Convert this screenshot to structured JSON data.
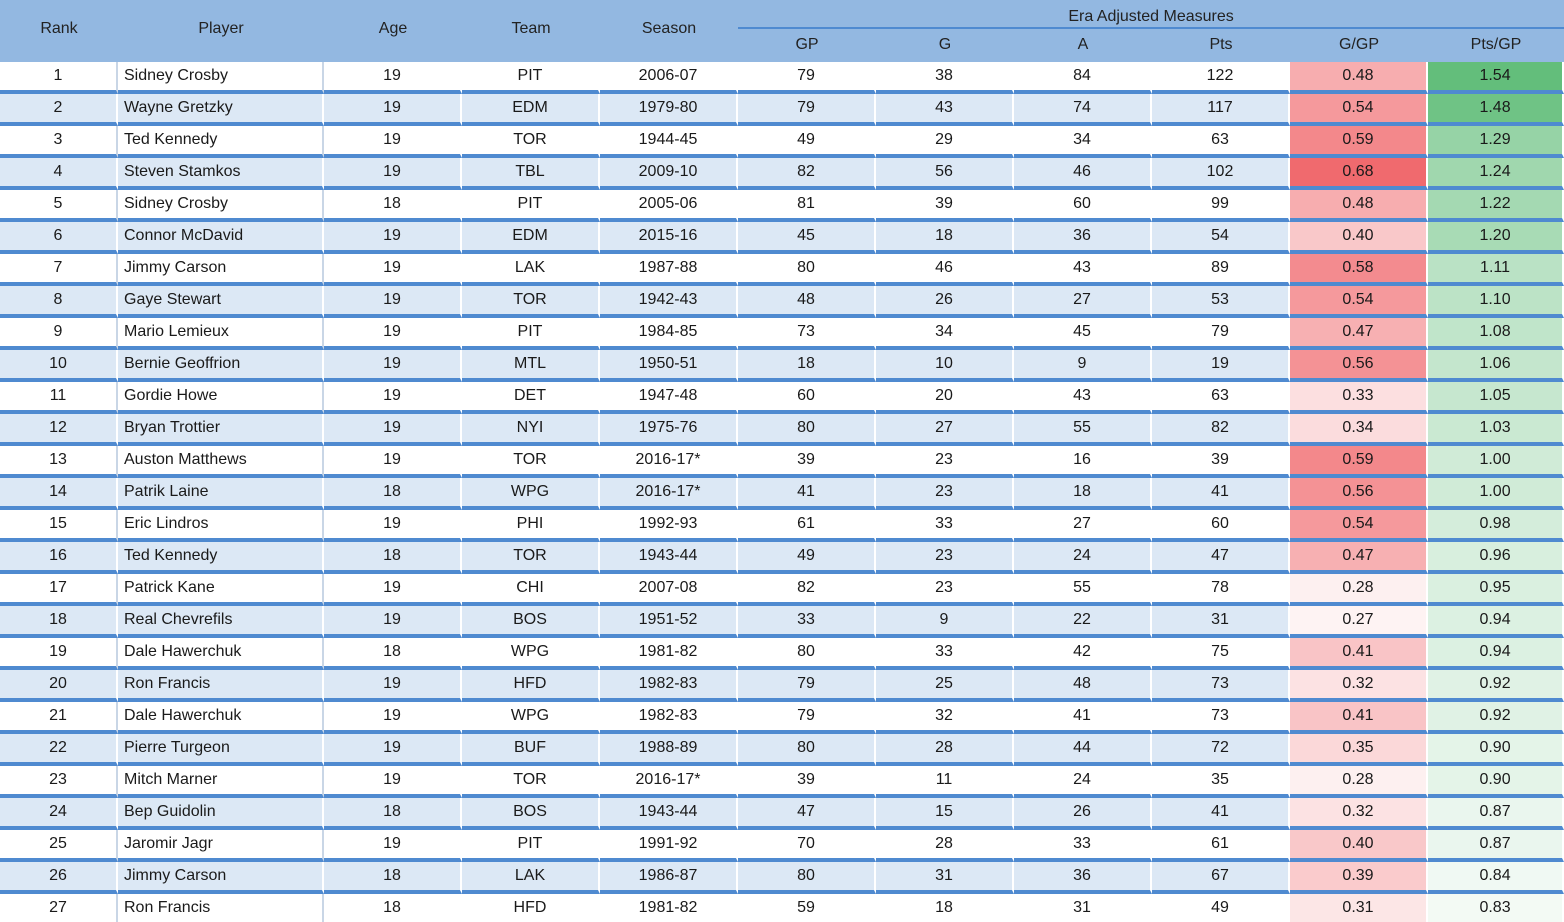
{
  "header": {
    "group_title": "Era Adjusted Measures",
    "columns": {
      "rank": "Rank",
      "player": "Player",
      "age": "Age",
      "team": "Team",
      "season": "Season",
      "gp": "GP",
      "g": "G",
      "a": "A",
      "pts": "Pts",
      "g_per_gp": "G/GP",
      "pts_per_gp": "Pts/GP"
    }
  },
  "colors": {
    "header_bg": "#93b8e1",
    "row_alt_bg": "#dce8f5",
    "row_divider": "#4f8ad0",
    "heat_red": "#f06a6e",
    "heat_green": "#63be7b"
  },
  "rows": [
    {
      "rank": "1",
      "player": "Sidney Crosby",
      "age": "19",
      "team": "PIT",
      "season": "2006-07",
      "gp": "79",
      "g": "38",
      "a": "84",
      "pts": "122",
      "g_per_gp": "0.48",
      "pts_per_gp": "1.54"
    },
    {
      "rank": "2",
      "player": "Wayne Gretzky",
      "age": "19",
      "team": "EDM",
      "season": "1979-80",
      "gp": "79",
      "g": "43",
      "a": "74",
      "pts": "117",
      "g_per_gp": "0.54",
      "pts_per_gp": "1.48"
    },
    {
      "rank": "3",
      "player": "Ted Kennedy",
      "age": "19",
      "team": "TOR",
      "season": "1944-45",
      "gp": "49",
      "g": "29",
      "a": "34",
      "pts": "63",
      "g_per_gp": "0.59",
      "pts_per_gp": "1.29"
    },
    {
      "rank": "4",
      "player": "Steven Stamkos",
      "age": "19",
      "team": "TBL",
      "season": "2009-10",
      "gp": "82",
      "g": "56",
      "a": "46",
      "pts": "102",
      "g_per_gp": "0.68",
      "pts_per_gp": "1.24"
    },
    {
      "rank": "5",
      "player": "Sidney Crosby",
      "age": "18",
      "team": "PIT",
      "season": "2005-06",
      "gp": "81",
      "g": "39",
      "a": "60",
      "pts": "99",
      "g_per_gp": "0.48",
      "pts_per_gp": "1.22"
    },
    {
      "rank": "6",
      "player": "Connor McDavid",
      "age": "19",
      "team": "EDM",
      "season": "2015-16",
      "gp": "45",
      "g": "18",
      "a": "36",
      "pts": "54",
      "g_per_gp": "0.40",
      "pts_per_gp": "1.20"
    },
    {
      "rank": "7",
      "player": "Jimmy Carson",
      "age": "19",
      "team": "LAK",
      "season": "1987-88",
      "gp": "80",
      "g": "46",
      "a": "43",
      "pts": "89",
      "g_per_gp": "0.58",
      "pts_per_gp": "1.11"
    },
    {
      "rank": "8",
      "player": "Gaye Stewart",
      "age": "19",
      "team": "TOR",
      "season": "1942-43",
      "gp": "48",
      "g": "26",
      "a": "27",
      "pts": "53",
      "g_per_gp": "0.54",
      "pts_per_gp": "1.10"
    },
    {
      "rank": "9",
      "player": "Mario Lemieux",
      "age": "19",
      "team": "PIT",
      "season": "1984-85",
      "gp": "73",
      "g": "34",
      "a": "45",
      "pts": "79",
      "g_per_gp": "0.47",
      "pts_per_gp": "1.08"
    },
    {
      "rank": "10",
      "player": "Bernie Geoffrion",
      "age": "19",
      "team": "MTL",
      "season": "1950-51",
      "gp": "18",
      "g": "10",
      "a": "9",
      "pts": "19",
      "g_per_gp": "0.56",
      "pts_per_gp": "1.06"
    },
    {
      "rank": "11",
      "player": "Gordie Howe",
      "age": "19",
      "team": "DET",
      "season": "1947-48",
      "gp": "60",
      "g": "20",
      "a": "43",
      "pts": "63",
      "g_per_gp": "0.33",
      "pts_per_gp": "1.05"
    },
    {
      "rank": "12",
      "player": "Bryan Trottier",
      "age": "19",
      "team": "NYI",
      "season": "1975-76",
      "gp": "80",
      "g": "27",
      "a": "55",
      "pts": "82",
      "g_per_gp": "0.34",
      "pts_per_gp": "1.03"
    },
    {
      "rank": "13",
      "player": "Auston Matthews",
      "age": "19",
      "team": "TOR",
      "season": "2016-17*",
      "gp": "39",
      "g": "23",
      "a": "16",
      "pts": "39",
      "g_per_gp": "0.59",
      "pts_per_gp": "1.00"
    },
    {
      "rank": "14",
      "player": "Patrik Laine",
      "age": "18",
      "team": "WPG",
      "season": "2016-17*",
      "gp": "41",
      "g": "23",
      "a": "18",
      "pts": "41",
      "g_per_gp": "0.56",
      "pts_per_gp": "1.00"
    },
    {
      "rank": "15",
      "player": "Eric Lindros",
      "age": "19",
      "team": "PHI",
      "season": "1992-93",
      "gp": "61",
      "g": "33",
      "a": "27",
      "pts": "60",
      "g_per_gp": "0.54",
      "pts_per_gp": "0.98"
    },
    {
      "rank": "16",
      "player": "Ted Kennedy",
      "age": "18",
      "team": "TOR",
      "season": "1943-44",
      "gp": "49",
      "g": "23",
      "a": "24",
      "pts": "47",
      "g_per_gp": "0.47",
      "pts_per_gp": "0.96"
    },
    {
      "rank": "17",
      "player": "Patrick Kane",
      "age": "19",
      "team": "CHI",
      "season": "2007-08",
      "gp": "82",
      "g": "23",
      "a": "55",
      "pts": "78",
      "g_per_gp": "0.28",
      "pts_per_gp": "0.95"
    },
    {
      "rank": "18",
      "player": "Real Chevrefils",
      "age": "19",
      "team": "BOS",
      "season": "1951-52",
      "gp": "33",
      "g": "9",
      "a": "22",
      "pts": "31",
      "g_per_gp": "0.27",
      "pts_per_gp": "0.94"
    },
    {
      "rank": "19",
      "player": "Dale Hawerchuk",
      "age": "18",
      "team": "WPG",
      "season": "1981-82",
      "gp": "80",
      "g": "33",
      "a": "42",
      "pts": "75",
      "g_per_gp": "0.41",
      "pts_per_gp": "0.94"
    },
    {
      "rank": "20",
      "player": "Ron Francis",
      "age": "19",
      "team": "HFD",
      "season": "1982-83",
      "gp": "79",
      "g": "25",
      "a": "48",
      "pts": "73",
      "g_per_gp": "0.32",
      "pts_per_gp": "0.92"
    },
    {
      "rank": "21",
      "player": "Dale Hawerchuk",
      "age": "19",
      "team": "WPG",
      "season": "1982-83",
      "gp": "79",
      "g": "32",
      "a": "41",
      "pts": "73",
      "g_per_gp": "0.41",
      "pts_per_gp": "0.92"
    },
    {
      "rank": "22",
      "player": "Pierre Turgeon",
      "age": "19",
      "team": "BUF",
      "season": "1988-89",
      "gp": "80",
      "g": "28",
      "a": "44",
      "pts": "72",
      "g_per_gp": "0.35",
      "pts_per_gp": "0.90"
    },
    {
      "rank": "23",
      "player": "Mitch Marner",
      "age": "19",
      "team": "TOR",
      "season": "2016-17*",
      "gp": "39",
      "g": "11",
      "a": "24",
      "pts": "35",
      "g_per_gp": "0.28",
      "pts_per_gp": "0.90"
    },
    {
      "rank": "24",
      "player": "Bep Guidolin",
      "age": "18",
      "team": "BOS",
      "season": "1943-44",
      "gp": "47",
      "g": "15",
      "a": "26",
      "pts": "41",
      "g_per_gp": "0.32",
      "pts_per_gp": "0.87"
    },
    {
      "rank": "25",
      "player": "Jaromir Jagr",
      "age": "19",
      "team": "PIT",
      "season": "1991-92",
      "gp": "70",
      "g": "28",
      "a": "33",
      "pts": "61",
      "g_per_gp": "0.40",
      "pts_per_gp": "0.87"
    },
    {
      "rank": "26",
      "player": "Jimmy Carson",
      "age": "18",
      "team": "LAK",
      "season": "1986-87",
      "gp": "80",
      "g": "31",
      "a": "36",
      "pts": "67",
      "g_per_gp": "0.39",
      "pts_per_gp": "0.84"
    },
    {
      "rank": "27",
      "player": "Ron Francis",
      "age": "18",
      "team": "HFD",
      "season": "1981-82",
      "gp": "59",
      "g": "18",
      "a": "31",
      "pts": "49",
      "g_per_gp": "0.31",
      "pts_per_gp": "0.83"
    }
  ]
}
